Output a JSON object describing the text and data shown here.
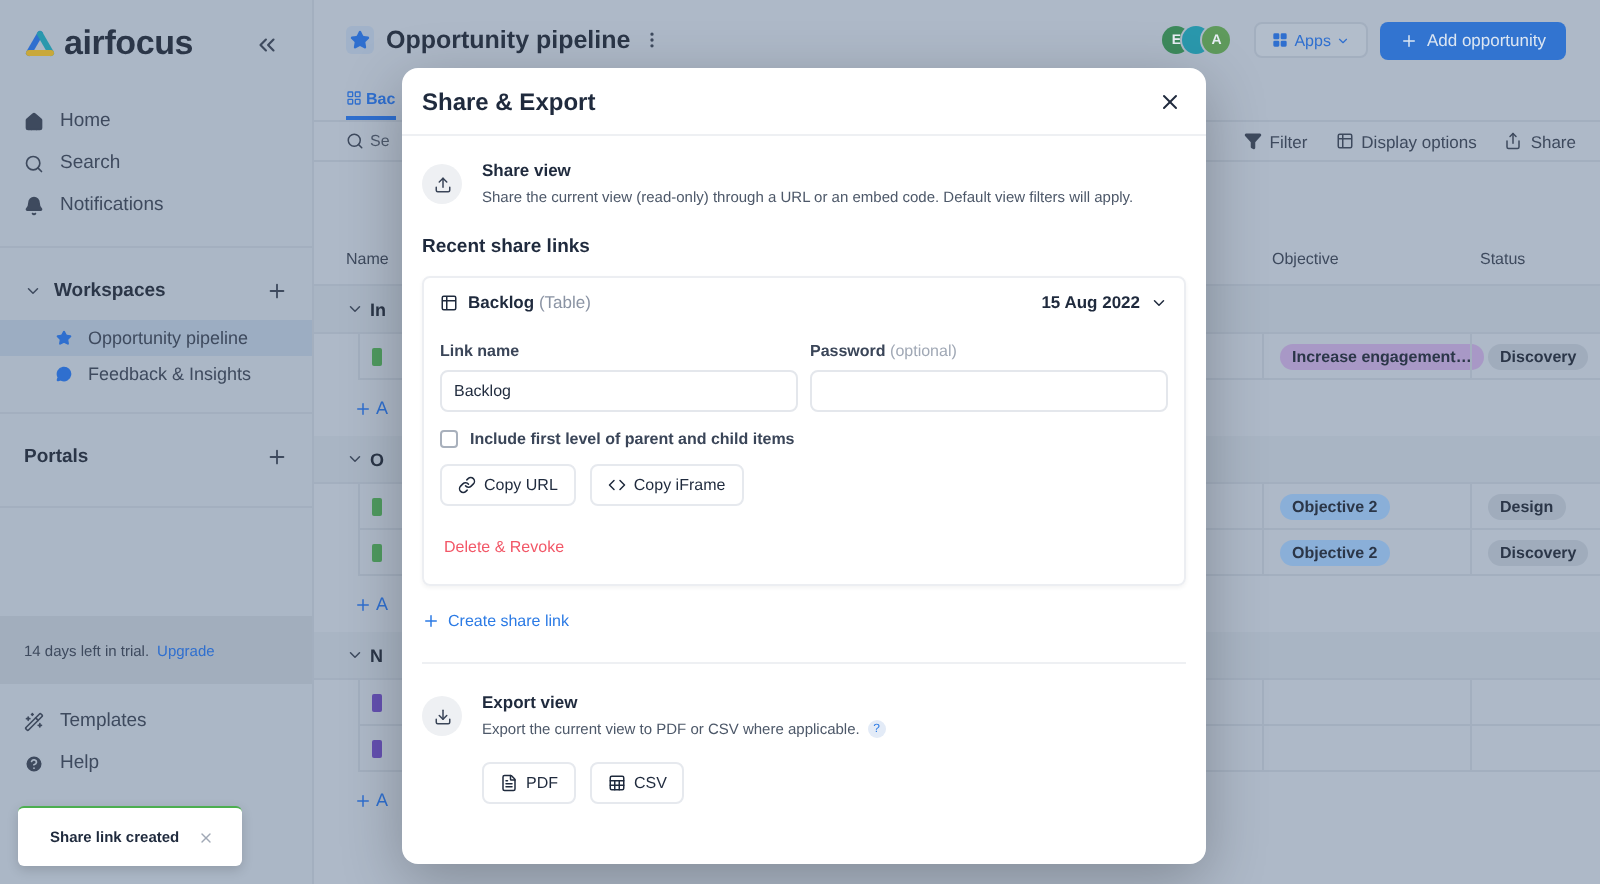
{
  "sidebar": {
    "logo": "airfocus",
    "nav": [
      {
        "label": "Home",
        "kind": "home"
      },
      {
        "label": "Search",
        "kind": "search"
      },
      {
        "label": "Notifications",
        "kind": "bell"
      }
    ],
    "workspaces": {
      "title": "Workspaces",
      "expanded": true,
      "items": [
        {
          "label": "Opportunity pipeline",
          "kind": "star",
          "selected": true
        },
        {
          "label": "Feedback & Insights",
          "kind": "chat",
          "selected": false
        }
      ]
    },
    "portals": {
      "title": "Portals"
    },
    "trial": {
      "text": "14 days left in trial.",
      "link": "Upgrade"
    },
    "bottom": [
      {
        "label": "Templates",
        "kind": "wand"
      },
      {
        "label": "Help",
        "kind": "help"
      }
    ]
  },
  "header": {
    "title": "Opportunity pipeline",
    "avatars": [
      {
        "initial": "E",
        "color": "#3d8a5c"
      },
      {
        "color": "#2a98ad"
      },
      {
        "initial": "A",
        "color": "#5f9a5c"
      }
    ],
    "apps_button": "Apps",
    "add_button": "Add opportunity"
  },
  "tabs": [
    {
      "label": "Bac",
      "selected": true
    }
  ],
  "toolbar": {
    "search_placeholder": "Se",
    "actions": [
      {
        "label": "Filter",
        "kind": "filter"
      },
      {
        "label": "Display options",
        "kind": "display"
      },
      {
        "label": "Share",
        "kind": "share"
      }
    ]
  },
  "table": {
    "columns": [
      "Name",
      "Objective",
      "Status"
    ],
    "groups": [
      {
        "name": "In",
        "expanded": true,
        "add_label": "A",
        "rows": [
          {
            "color": "#4f9a5f",
            "objective": {
              "label": "Increase engagement…",
              "color": "#a898c6"
            },
            "status": "Discovery"
          }
        ]
      },
      {
        "name": "O",
        "expanded": true,
        "add_label": "A",
        "rows": [
          {
            "color": "#4f9a5f",
            "objective": {
              "label": "Objective 2",
              "color": "#8aafd8"
            },
            "status": "Design"
          },
          {
            "color": "#4f9a5f",
            "objective": {
              "label": "Objective 2",
              "color": "#8aafd8"
            },
            "status": "Discovery"
          }
        ]
      },
      {
        "name": "N",
        "expanded": true,
        "add_label": "A",
        "rows": [
          {
            "color": "#6450b0"
          },
          {
            "color": "#6450b0"
          }
        ]
      }
    ]
  },
  "dialog": {
    "title": "Share & Export",
    "share": {
      "title": "Share view",
      "description": "Share the current view (read-only) through a URL or an embed code. Default view filters will apply."
    },
    "recent_title": "Recent share links",
    "links": [
      {
        "name": "Backlog",
        "type": "(Table)",
        "date": "15 Aug 2022",
        "expanded": true,
        "link_label": "Link name",
        "link_value": "Backlog",
        "password_label": "Password",
        "password_hint": "(optional)",
        "include": {
          "label": "Include first level of parent and child items",
          "checked": false
        },
        "buttons": [
          {
            "label": "Copy URL",
            "kind": "link"
          },
          {
            "label": "Copy iFrame",
            "kind": "code"
          }
        ],
        "delete": "Delete & Revoke"
      }
    ],
    "create_link": "Create share link",
    "export": {
      "title": "Export view",
      "description": "Export the current view to PDF or CSV where applicable.",
      "help": "?",
      "buttons": [
        {
          "label": "PDF",
          "kind": "pdf"
        },
        {
          "label": "CSV",
          "kind": "csv"
        }
      ]
    }
  },
  "toast": {
    "text": "Share link created"
  }
}
